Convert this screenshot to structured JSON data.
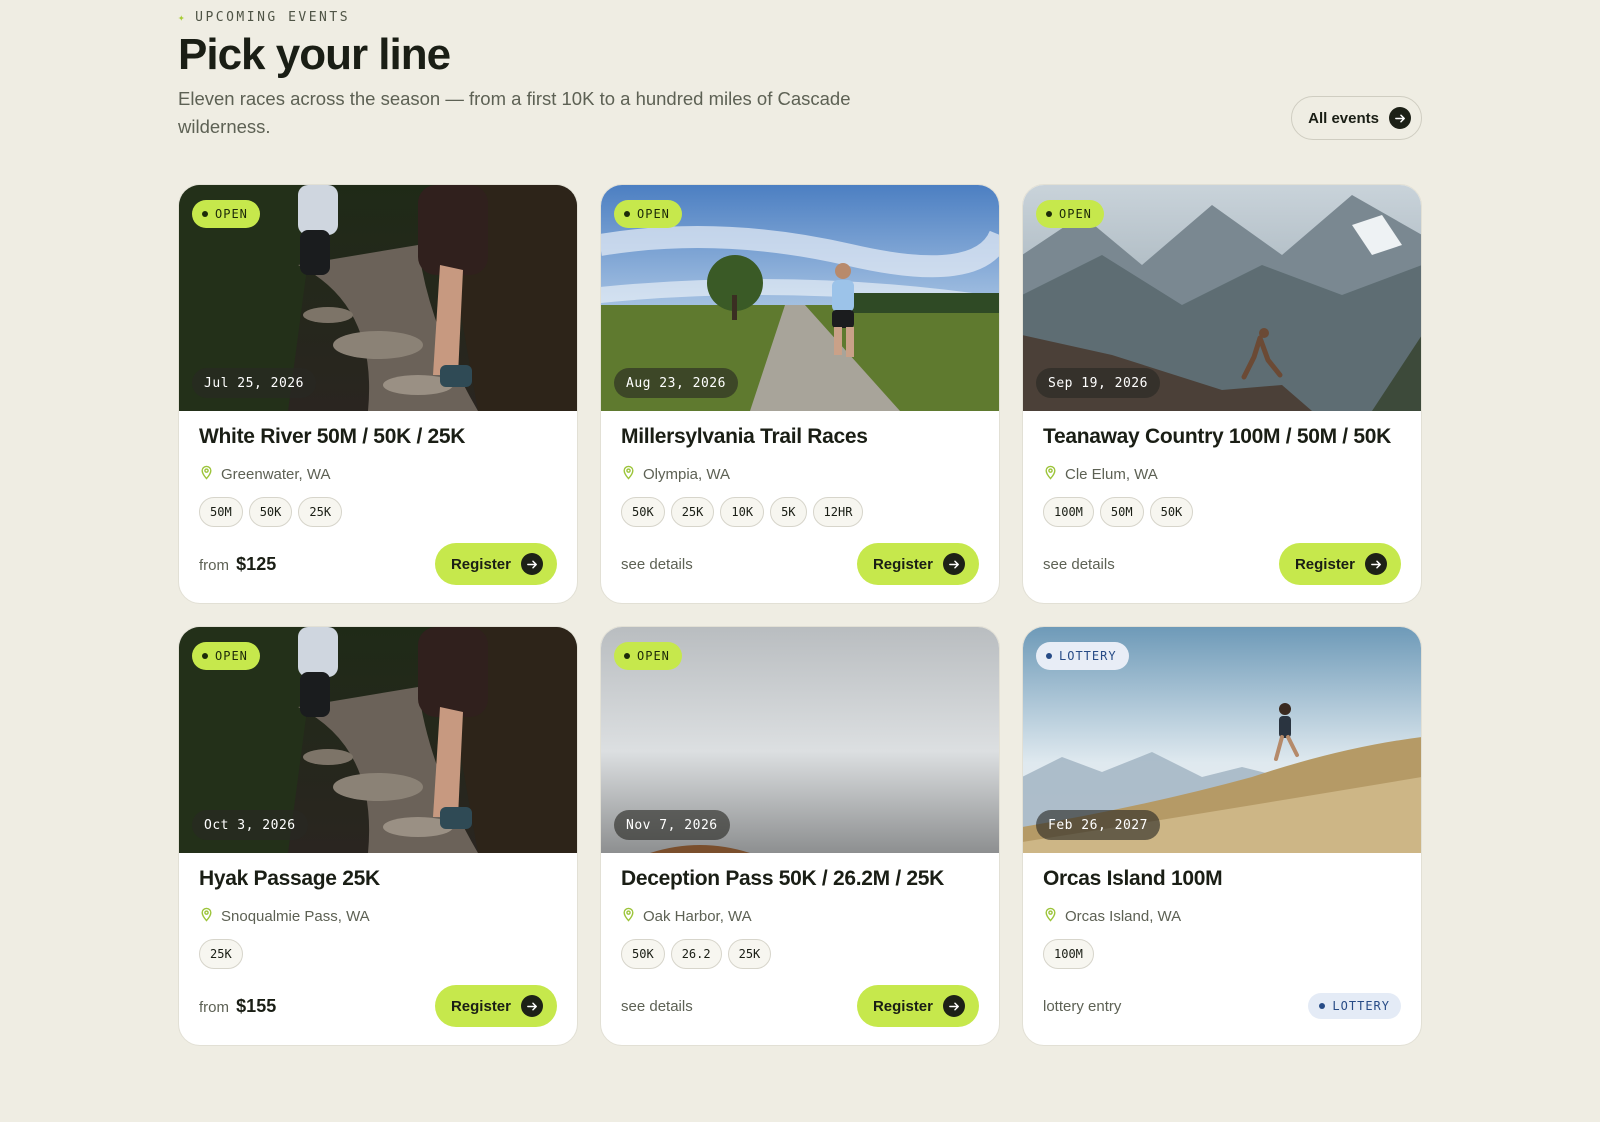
{
  "header": {
    "eyebrow": "UPCOMING EVENTS",
    "eyebrow_icon": "sparkle-icon",
    "title": "Pick your line",
    "subtitle": "Eleven races across the season — from a first 10K to a hundred miles of Cascade wilderness.",
    "all_events_label": "All events"
  },
  "colors": {
    "background": "#efede3",
    "accent": "#c6e84c",
    "lottery": "#274b86",
    "text": "#1a1e15"
  },
  "events": [
    {
      "status": "OPEN",
      "date": "Jul 25, 2026",
      "name": "White River 50M / 50K / 25K",
      "location": "Greenwater, WA",
      "tags": [
        "50M",
        "50K",
        "25K"
      ],
      "price_prefix": "from",
      "price": "$125",
      "cta": "Register",
      "image": "forest-trail-runners"
    },
    {
      "status": "OPEN",
      "date": "Aug 23, 2026",
      "name": "Millersylvania Trail Races",
      "location": "Olympia, WA",
      "tags": [
        "50K",
        "25K",
        "10K",
        "5K",
        "12HR"
      ],
      "details": "see details",
      "cta": "Register",
      "image": "gravel-road-runner"
    },
    {
      "status": "OPEN",
      "date": "Sep 19, 2026",
      "name": "Teanaway Country 100M / 50M / 50K",
      "location": "Cle Elum, WA",
      "tags": [
        "100M",
        "50M",
        "50K"
      ],
      "details": "see details",
      "cta": "Register",
      "image": "alpine-ridge-runner"
    },
    {
      "status": "OPEN",
      "date": "Oct 3, 2026",
      "name": "Hyak Passage 25K",
      "location": "Snoqualmie Pass, WA",
      "tags": [
        "25K"
      ],
      "price_prefix": "from",
      "price": "$155",
      "cta": "Register",
      "image": "forest-trail-runners"
    },
    {
      "status": "OPEN",
      "date": "Nov 7, 2026",
      "name": "Deception Pass 50K / 26.2M / 25K",
      "location": "Oak Harbor, WA",
      "tags": [
        "50K",
        "26.2",
        "25K"
      ],
      "details": "see details",
      "cta": "Register",
      "image": "foggy-sky"
    },
    {
      "status": "LOTTERY",
      "date": "Feb 26, 2027",
      "name": "Orcas Island 100M",
      "location": "Orcas Island, WA",
      "tags": [
        "100M"
      ],
      "details": "lottery entry",
      "footer_badge": "LOTTERY",
      "image": "grassy-hill-runner"
    }
  ]
}
